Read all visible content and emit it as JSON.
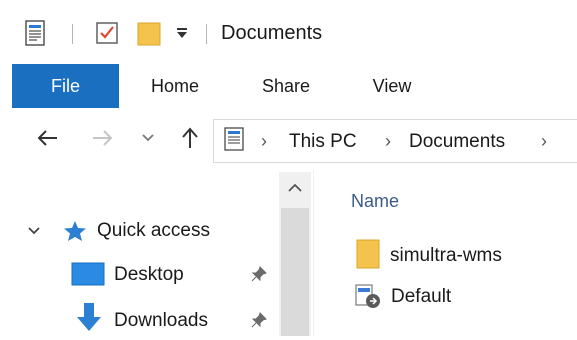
{
  "window": {
    "title": "Documents"
  },
  "ribbon": {
    "tabs": [
      {
        "label": "File",
        "active": true
      },
      {
        "label": "Home"
      },
      {
        "label": "Share"
      },
      {
        "label": "View"
      }
    ]
  },
  "address": {
    "crumbs": [
      "This PC",
      "Documents"
    ]
  },
  "nav_pane": {
    "items": [
      {
        "label": "Quick access",
        "icon": "star-icon",
        "expanded": true
      },
      {
        "label": "Desktop",
        "icon": "desktop-folder-icon",
        "pinned": true
      },
      {
        "label": "Downloads",
        "icon": "download-arrow-icon",
        "pinned": true
      }
    ]
  },
  "content": {
    "column_header": "Name",
    "files": [
      {
        "name": "simultra-wms",
        "icon": "folder-icon"
      },
      {
        "name": "Default",
        "icon": "shortcut-icon"
      }
    ]
  },
  "colors": {
    "accent": "#1a6fc1",
    "folder": "#f3c34d",
    "header_text": "#3b5b8c"
  }
}
